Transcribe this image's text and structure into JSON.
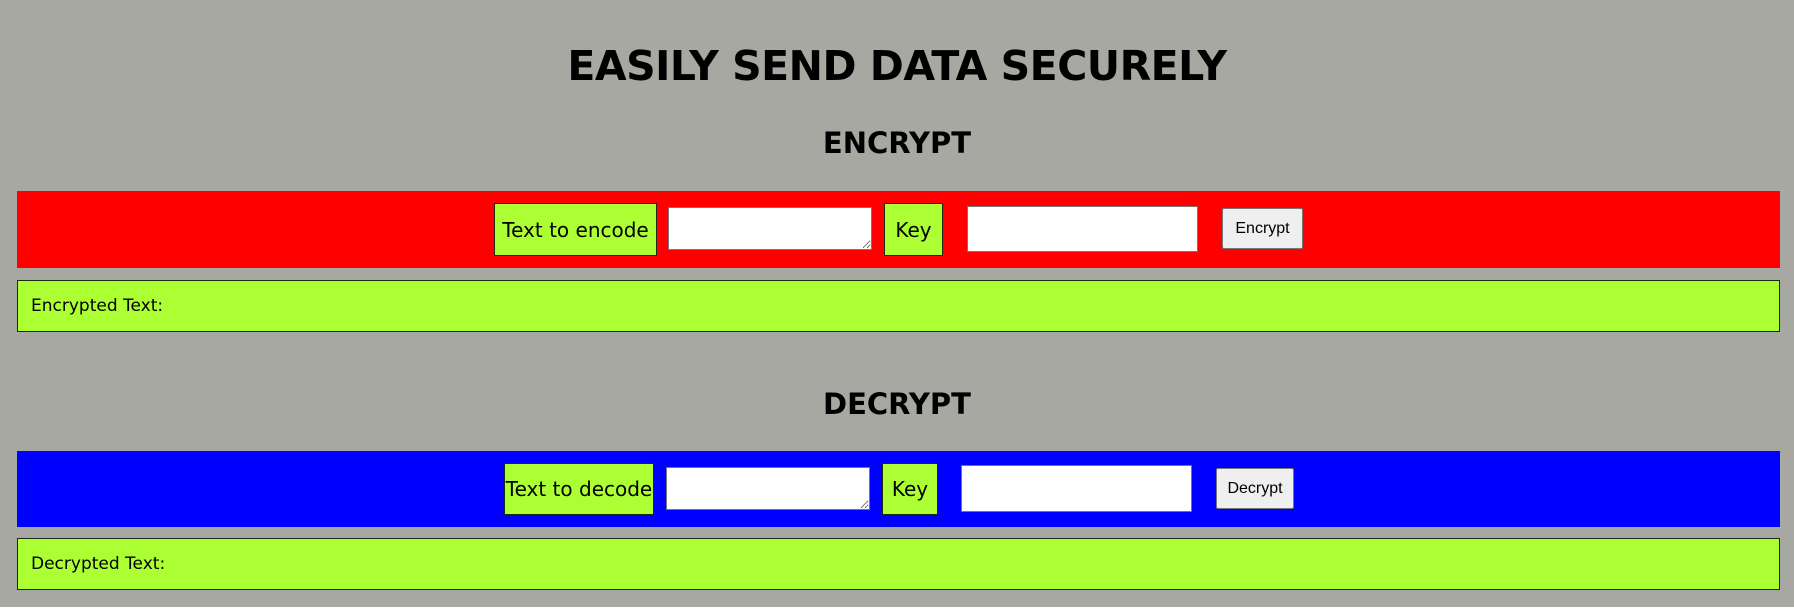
{
  "header": {
    "title": "EASILY SEND DATA SECURELY"
  },
  "encrypt": {
    "section_title": "ENCRYPT",
    "text_label": "Text to encode",
    "text_value": "",
    "key_label": "Key",
    "key_value": "",
    "button_label": "Encrypt",
    "result_label": "Encrypted Text:",
    "band_color": "#ff0000"
  },
  "decrypt": {
    "section_title": "DECRYPT",
    "text_label": "Text to decode",
    "text_value": "",
    "key_label": "Key",
    "key_value": "",
    "button_label": "Decrypt",
    "result_label": "Decrypted Text:",
    "band_color": "#0000ff"
  },
  "colors": {
    "background": "#a7a8a2",
    "label_green": "#abff33"
  }
}
